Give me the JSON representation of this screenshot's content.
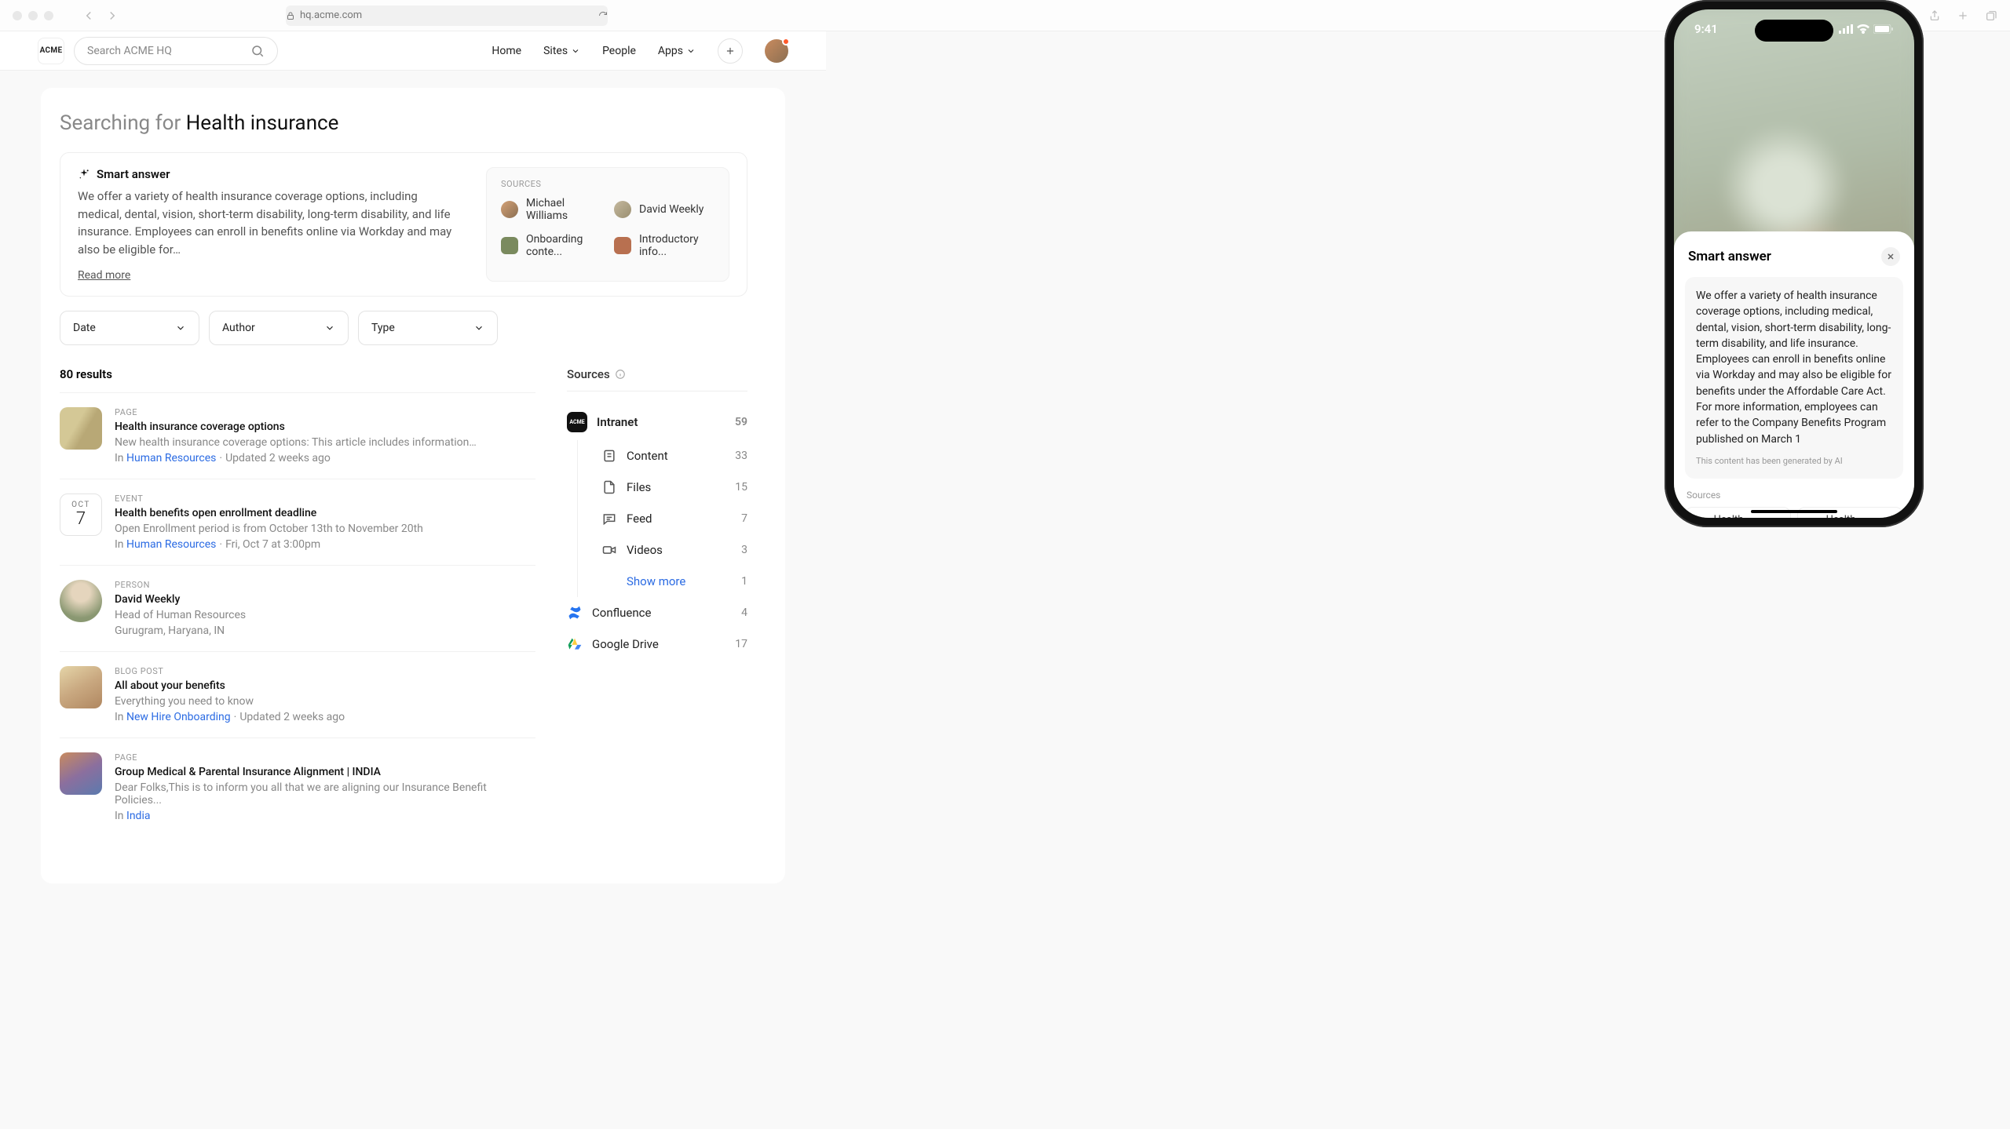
{
  "chrome": {
    "url": "hq.acme.com"
  },
  "header": {
    "logo": "ACME",
    "search_placeholder": "Search ACME HQ",
    "nav": {
      "home": "Home",
      "sites": "Sites",
      "people": "People",
      "apps": "Apps"
    }
  },
  "search": {
    "prefix": "Searching for ",
    "query": "Health insurance"
  },
  "smart_answer": {
    "label": "Smart answer",
    "body": "We offer a variety of health insurance coverage options, including medical, dental, vision, short-term disability, long-term disability, and life insurance. Employees can enroll in benefits online via Workday and may also be eligible for…",
    "read_more": "Read more",
    "sources_label": "SOURCES",
    "sources": [
      {
        "name": "Michael Williams"
      },
      {
        "name": "David Weekly"
      },
      {
        "name": "Onboarding conte..."
      },
      {
        "name": "Introductory info..."
      }
    ]
  },
  "filters": {
    "date": "Date",
    "author": "Author",
    "type": "Type"
  },
  "results": {
    "count": "80 results",
    "items": [
      {
        "kind": "thumb",
        "type": "PAGE",
        "title": "Health insurance coverage options",
        "snippet": "New health insurance coverage options: This article includes information…",
        "loc_pre": "In ",
        "loc_link": "Human Resources",
        "loc_post": "Updated 2 weeks ago"
      },
      {
        "kind": "cal",
        "month": "OCT",
        "day": "7",
        "type": "EVENT",
        "title": "Health benefits open enrollment deadline",
        "snippet": "Open Enrollment period is from October 13th to November 20th",
        "loc_pre": "In ",
        "loc_link": "Human Resources",
        "loc_post": "Fri, Oct 7 at 3:00pm"
      },
      {
        "kind": "person",
        "type": "PERSON",
        "title": "David Weekly",
        "snippet": "Head of Human Resources",
        "loc_plain": "Gurugram, Haryana, IN"
      },
      {
        "kind": "thumb",
        "type": "BLOG POST",
        "title": "All about your benefits",
        "snippet": "Everything you need to know",
        "loc_pre": "In ",
        "loc_link": "New Hire Onboarding",
        "loc_post": "Updated 2 weeks ago"
      },
      {
        "kind": "thumb",
        "type": "PAGE",
        "title": "Group Medical & Parental Insurance Alignment | INDIA",
        "snippet": "Dear Folks,This is to inform you all that we are aligning our Insurance Benefit Policies...",
        "loc_pre": "In ",
        "loc_link": "India"
      }
    ]
  },
  "source_panel": {
    "title": "Sources",
    "intranet": {
      "name": "Intranet",
      "count": "59"
    },
    "children": [
      {
        "icon": "doc",
        "name": "Content",
        "count": "33"
      },
      {
        "icon": "file",
        "name": "Files",
        "count": "15"
      },
      {
        "icon": "chat",
        "name": "Feed",
        "count": "7"
      },
      {
        "icon": "video",
        "name": "Videos",
        "count": "3"
      },
      {
        "icon": "more",
        "name": "Show more",
        "count": "1"
      }
    ],
    "confluence": {
      "name": "Confluence",
      "count": "4"
    },
    "gdrive": {
      "name": "Google Drive",
      "count": "17"
    }
  },
  "phone": {
    "time": "9:41",
    "sheet_title": "Smart answer",
    "body": "We offer a variety of health insurance coverage options, including medical, dental, vision, short-term disability, long-term disability, and life insurance. Employees can enroll in benefits online via Workday and may also be eligible for benefits under the Affordable Care Act. For more information, employees can refer to the Company Benefits Program published on March 1",
    "disclaimer": "This content has been generated by AI",
    "sources_label": "Sources",
    "chips": [
      "Health insuranc…",
      "Health Insuranc…"
    ]
  }
}
